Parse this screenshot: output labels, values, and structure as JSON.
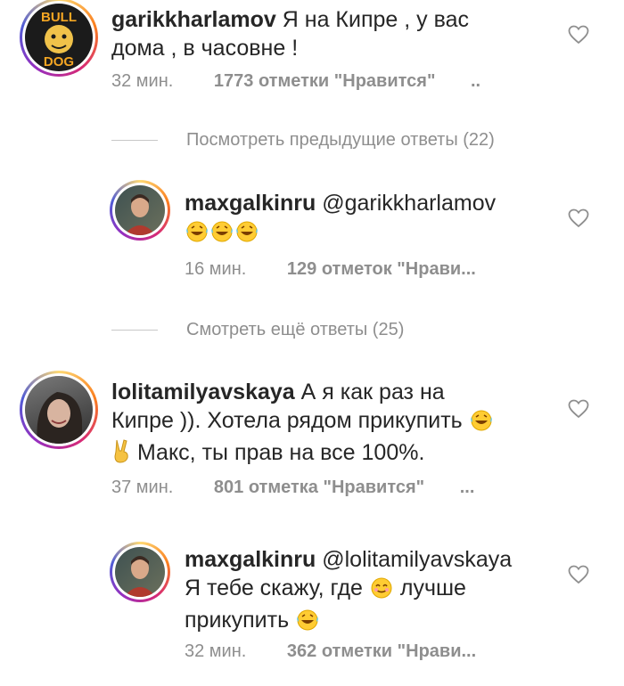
{
  "comments": [
    {
      "username": "garikkharlamov",
      "text_line1": "Я на Кипре , у вас",
      "text_line2": "дома , в часовне !",
      "time": "32 мин.",
      "likes": "1773 отметки \"Нравится\"",
      "more": "..",
      "avatar_logo_top": "BULL",
      "avatar_logo_bottom": "DOG"
    },
    {
      "username": "maxgalkinru",
      "mention": "@garikkharlamov",
      "time": "16 мин.",
      "likes": "129 отметок \"Нрави..."
    },
    {
      "username": "lolitamilyavskaya",
      "text_line1": "А я как раз на",
      "text_line2": "Кипре )). Хотела рядом прикупить",
      "text_line3": "Макс, ты прав на все 100%.",
      "time": "37 мин.",
      "likes": "801 отметка \"Нравится\"",
      "more": "..."
    },
    {
      "username": "maxgalkinru",
      "mention": "@lolitamilyavskaya",
      "text_line2a": "Я тебе скажу, где",
      "text_line2b": "лучше",
      "text_line3": "прикупить",
      "time": "32 мин.",
      "likes": "362 отметки \"Нрави..."
    }
  ],
  "view_replies_1": "Посмотреть предыдущие ответы (22)",
  "view_replies_2": "Смотреть ещё ответы (25)",
  "colors": {
    "text": "#262626",
    "meta": "#8e8e8e",
    "line": "#c7c7c7"
  },
  "icons": [
    "heart-outline-icon",
    "laughing-emoji-icon",
    "smiling-emoji-icon",
    "victory-hand-icon"
  ]
}
